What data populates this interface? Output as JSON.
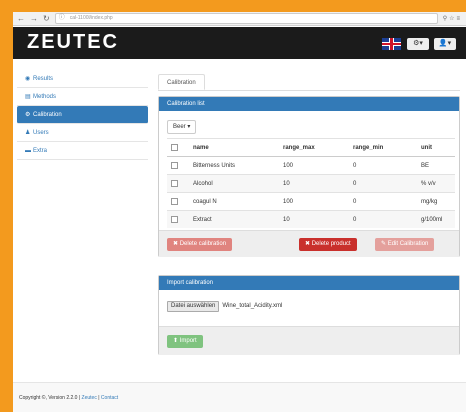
{
  "browser": {
    "address": "cal-1100l/index.php",
    "back_icon": "arrow-left",
    "forward_icon": "arrow-right",
    "reload_icon": "reload"
  },
  "header": {
    "logo": "ZEUTEC",
    "settings_caret": "▾",
    "user_caret": "▾"
  },
  "sidebar": {
    "items": [
      {
        "label": "Results",
        "icon": "circle-icon"
      },
      {
        "label": "Methods",
        "icon": "list-icon"
      },
      {
        "label": "Calibration",
        "icon": "gear-icon",
        "active": true
      },
      {
        "label": "Users",
        "icon": "user-icon"
      },
      {
        "label": "Extra",
        "icon": "bookmark-icon"
      }
    ]
  },
  "main": {
    "tab": "Calibration",
    "calibration_panel": {
      "title": "Calibration list",
      "select_value": "Beer",
      "columns": [
        "name",
        "range_max",
        "range_min",
        "unit"
      ],
      "rows": [
        {
          "name": "Bitterness Units",
          "range_max": "100",
          "range_min": "0",
          "unit": "BE"
        },
        {
          "name": "Alcohol",
          "range_max": "10",
          "range_min": "0",
          "unit": "% v/v"
        },
        {
          "name": "coagul N",
          "range_max": "100",
          "range_min": "0",
          "unit": "mg/kg"
        },
        {
          "name": "Extract",
          "range_max": "10",
          "range_min": "0",
          "unit": "g/100ml"
        }
      ],
      "buttons": {
        "delete_calibration": "Delete calibration",
        "delete_product": "Delete product",
        "edit_calibration": "Edit Calibration"
      }
    },
    "import_panel": {
      "title": "Import calibration",
      "file_button": "Datei auswählen",
      "file_name": "Wine_total_Acidity.xml",
      "import_button": "Import"
    }
  },
  "footer": {
    "copyright": "Copyright ©, Version 2.2.0 |",
    "zeutec": "Zeutec",
    "separator": "|",
    "contact": "Contact"
  }
}
